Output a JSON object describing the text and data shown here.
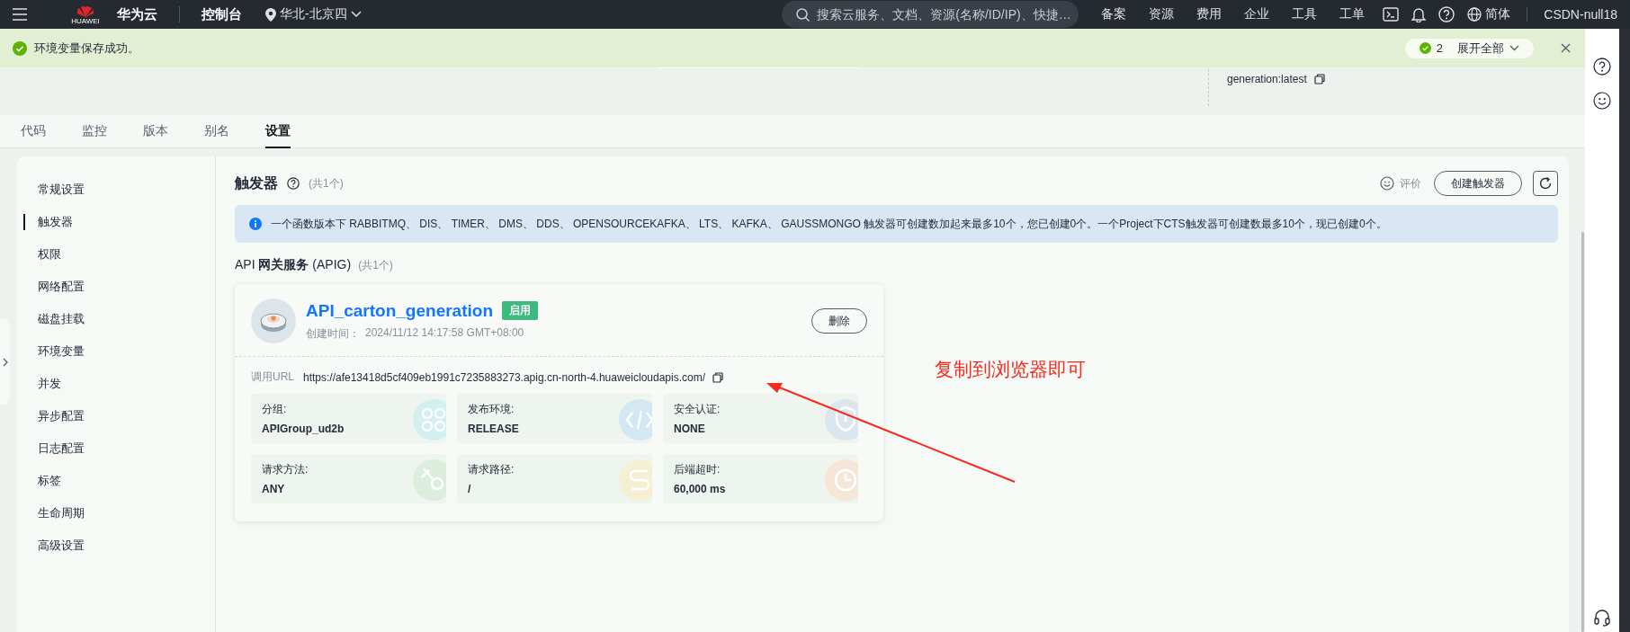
{
  "top_bar": {
    "logo_caption": "HUAWEI",
    "brand": "华为云",
    "console": "控制台",
    "region": "华北-北京四",
    "search_placeholder": "搜索云服务、文档、资源(名称/ID/IP)、快捷…",
    "nav": [
      "备案",
      "资源",
      "费用",
      "企业",
      "工具",
      "工单"
    ],
    "language": "简体",
    "account": "CSDN-null18"
  },
  "notification": {
    "message": "环境变量保存成功。",
    "count": "2",
    "expand": "展开全部"
  },
  "header": {
    "tag": "generation:latest"
  },
  "tabs": [
    {
      "label": "代码",
      "selected": false
    },
    {
      "label": "监控",
      "selected": false
    },
    {
      "label": "版本",
      "selected": false
    },
    {
      "label": "别名",
      "selected": false
    },
    {
      "label": "设置",
      "selected": true
    }
  ],
  "sidebar": {
    "items": [
      {
        "label": "常规设置",
        "selected": false
      },
      {
        "label": "触发器",
        "selected": true
      },
      {
        "label": "权限",
        "selected": false
      },
      {
        "label": "网络配置",
        "selected": false
      },
      {
        "label": "磁盘挂载",
        "selected": false
      },
      {
        "label": "环境变量",
        "selected": false
      },
      {
        "label": "并发",
        "selected": false
      },
      {
        "label": "异步配置",
        "selected": false
      },
      {
        "label": "日志配置",
        "selected": false
      },
      {
        "label": "标签",
        "selected": false
      },
      {
        "label": "生命周期",
        "selected": false
      },
      {
        "label": "高级设置",
        "selected": false
      }
    ]
  },
  "section": {
    "title": "触发器",
    "count": "(共1个)",
    "feedback": "评价",
    "create_button": "创建触发器",
    "notice": "一个函数版本下 RABBITMQ、 DIS、 TIMER、 DMS、 DDS、 OPENSOURCEKAFKA、 LTS、 KAFKA、 GAUSSMONGO 触发器可创建数加起来最多10个，您已创建0个。一个Project下CTS触发器可创建数最多10个，现已创建0个。",
    "group_title": "API **网关服务** (APIG)",
    "group_count": "(共1个)"
  },
  "trigger": {
    "name": "API_carton_generation",
    "status": "启用",
    "enabled": true,
    "created_label": "创建时间：",
    "created": "2024/11/12 14:17:58 GMT+08:00",
    "delete_button": "删除",
    "url_label": "调用URL",
    "url": "https://afe13418d5cf409eb1991c7235883273.apig.cn-north-4.huaweicloudapis.com/",
    "fields": [
      {
        "label": "分组:",
        "value": "APIGroup_ud2b",
        "kind": "group",
        "color": "#d4efef"
      },
      {
        "label": "发布环境:",
        "value": "RELEASE",
        "kind": "code",
        "color": "#d3e8f2"
      },
      {
        "label": "安全认证:",
        "value": "NONE",
        "kind": "shield",
        "color": "#dbe6ee"
      },
      {
        "label": "请求方法:",
        "value": "ANY",
        "kind": "method",
        "color": "#dbeedd"
      },
      {
        "label": "请求路径:",
        "value": "/",
        "kind": "path",
        "color": "#f5efd4"
      },
      {
        "label": "后端超时:",
        "value": "60,000 ms",
        "kind": "clock",
        "color": "#f5e6d8"
      }
    ]
  },
  "annotation": {
    "text": "复制到浏览器即可"
  }
}
